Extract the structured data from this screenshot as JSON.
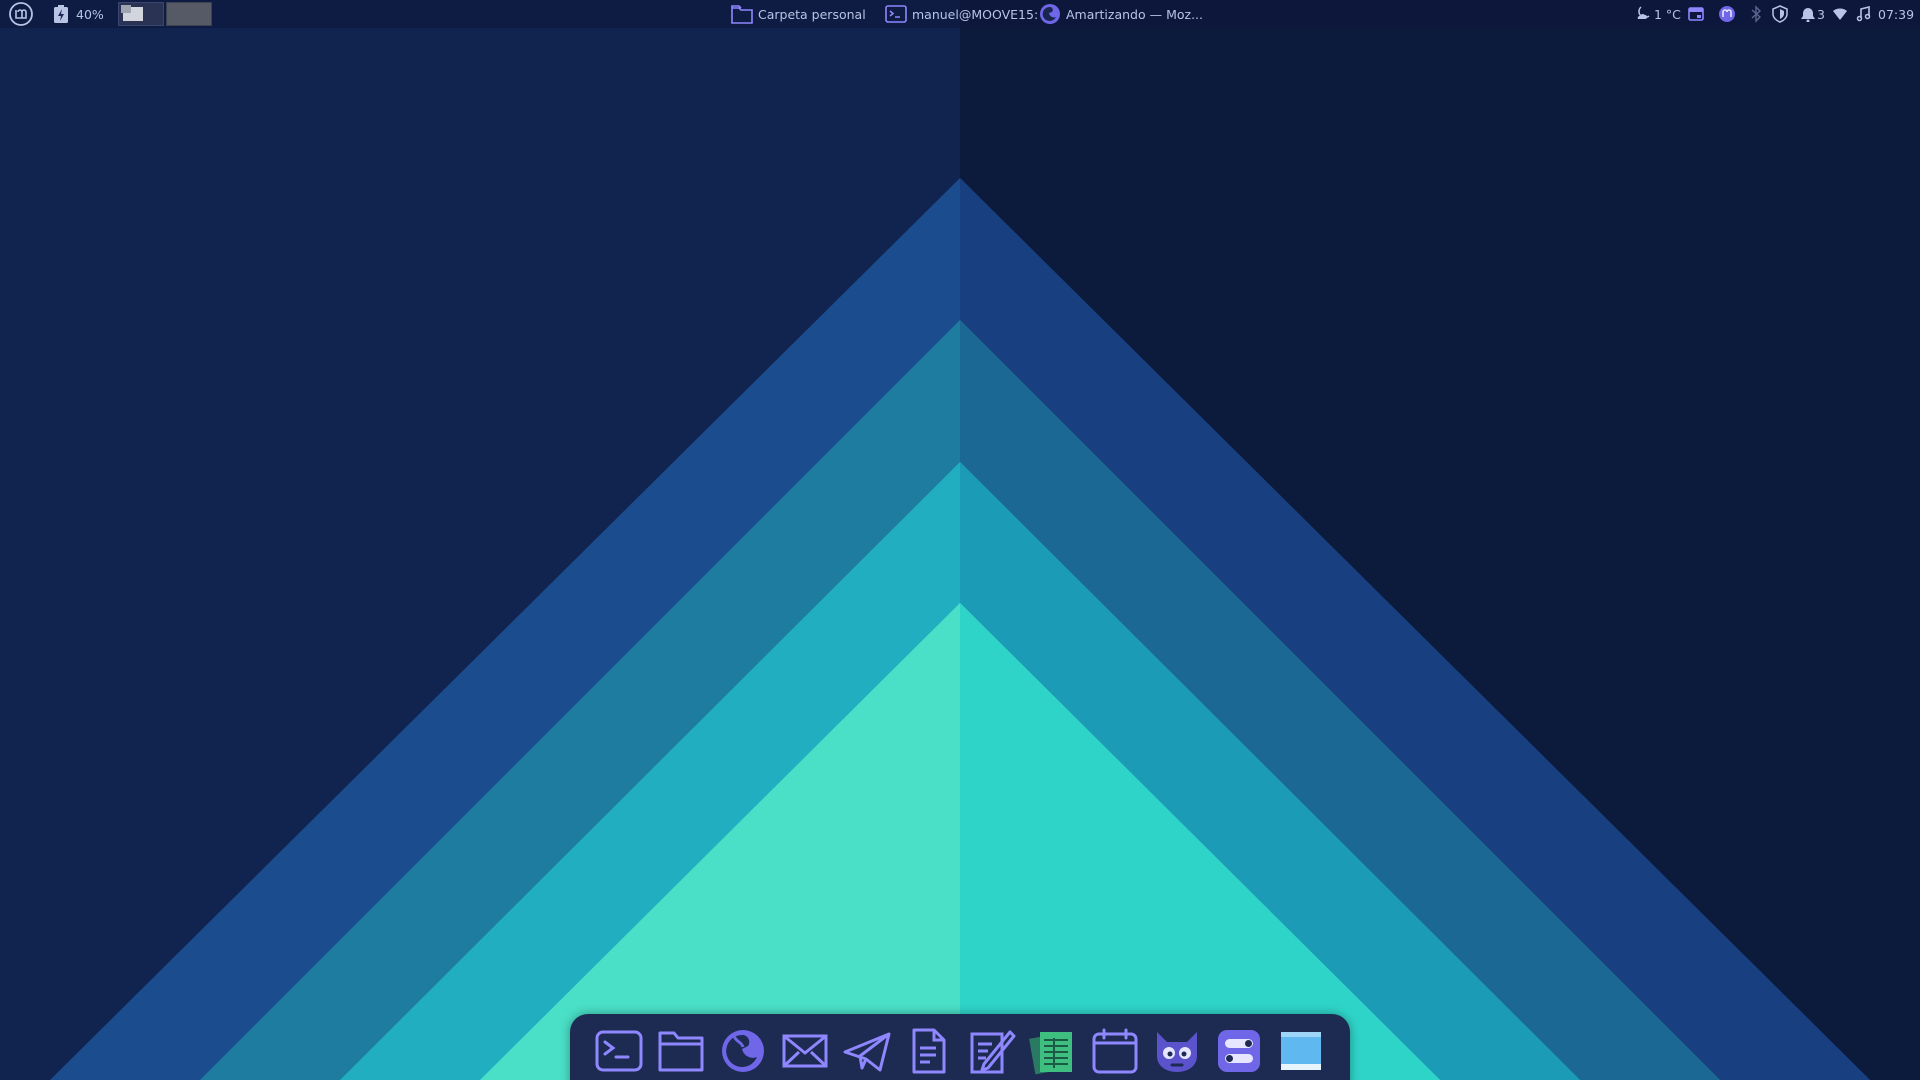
{
  "top_panel": {
    "menu": {
      "icon": "linux-mint-logo-icon"
    },
    "battery": {
      "icon": "battery-charging-icon",
      "percent_label": "40%"
    },
    "workspaces": {
      "count": 2,
      "active_index": 0
    },
    "tasks": [
      {
        "icon": "folder-icon",
        "label": "Carpeta personal"
      },
      {
        "icon": "terminal-icon",
        "label": "manuel@MOOVE15: ~"
      },
      {
        "icon": "firefox-icon",
        "label": "Amartizando — Moz..."
      }
    ],
    "tray": {
      "weather": {
        "icon": "night-cloud-icon",
        "label": "1 °C"
      },
      "notifications_count": "3",
      "clock": "07:39",
      "icons": [
        "calendar-notes-icon",
        "mastodon-icon",
        "bluetooth-icon",
        "shield-icon",
        "network-icon",
        "wifi-icon",
        "music-icon"
      ]
    }
  },
  "dock": {
    "items": [
      {
        "name": "terminal",
        "icon": "terminal-icon",
        "running": true
      },
      {
        "name": "files",
        "icon": "folder-icon",
        "running": true
      },
      {
        "name": "firefox",
        "icon": "firefox-icon",
        "running": true
      },
      {
        "name": "mail",
        "icon": "mail-icon",
        "running": false
      },
      {
        "name": "telegram",
        "icon": "telegram-icon",
        "running": false
      },
      {
        "name": "text-editor",
        "icon": "document-icon",
        "running": false
      },
      {
        "name": "notes",
        "icon": "notes-icon",
        "running": false
      },
      {
        "name": "spreadsheet",
        "icon": "spreadsheet-icon",
        "running": false
      },
      {
        "name": "calendar",
        "icon": "calendar-icon",
        "running": false
      },
      {
        "name": "gimp",
        "icon": "gimp-icon",
        "running": false
      },
      {
        "name": "settings",
        "icon": "settings-toggles-icon",
        "running": false
      },
      {
        "name": "show-desktop",
        "icon": "show-desktop-icon",
        "running": false
      }
    ]
  },
  "colors": {
    "accent": "#8f87ff",
    "panel_text": "#b9c3e6",
    "wallpaper_dark": "#0f1d44",
    "wallpaper_mint": "#44dfc8"
  }
}
